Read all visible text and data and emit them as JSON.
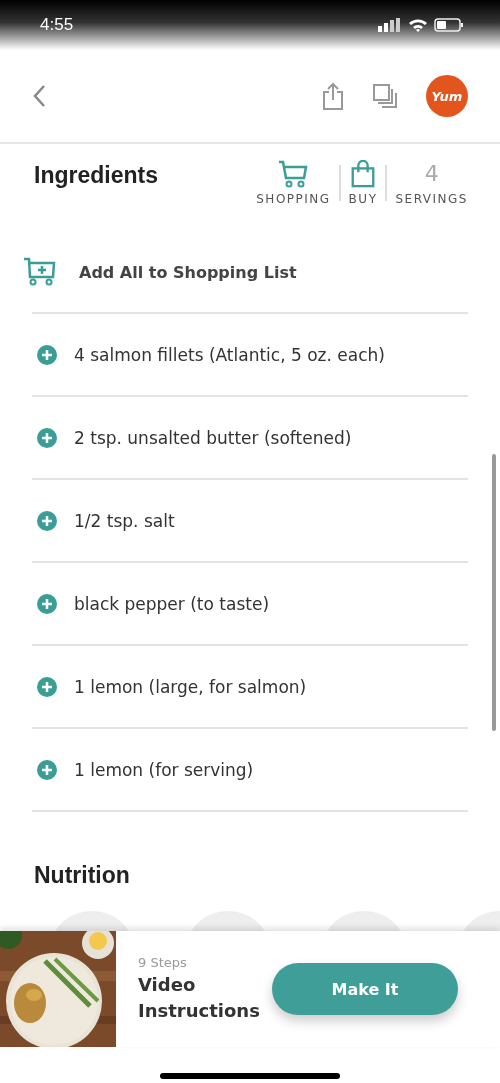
{
  "status_bar": {
    "time": "4:55"
  },
  "nav": {
    "logo": "Yum"
  },
  "ingredients": {
    "title": "Ingredients",
    "actions": [
      {
        "kind": "cart",
        "label": "SHOPPING"
      },
      {
        "kind": "bag",
        "label": "BUY"
      },
      {
        "kind": "count",
        "value": "4",
        "label": "SERVINGS"
      }
    ],
    "add_all": "Add All to Shopping List",
    "items": [
      "4 salmon fillets (Atlantic, 5 oz. each)",
      "2 tsp. unsalted butter (softened)",
      "1/2 tsp. salt",
      "black pepper (to taste)",
      "1 lemon (large, for salmon)",
      "1 lemon (for serving)"
    ]
  },
  "nutrition": {
    "title": "Nutrition"
  },
  "bottom_bar": {
    "steps": "9 Steps",
    "title": "Video Instructions",
    "button": "Make It"
  }
}
